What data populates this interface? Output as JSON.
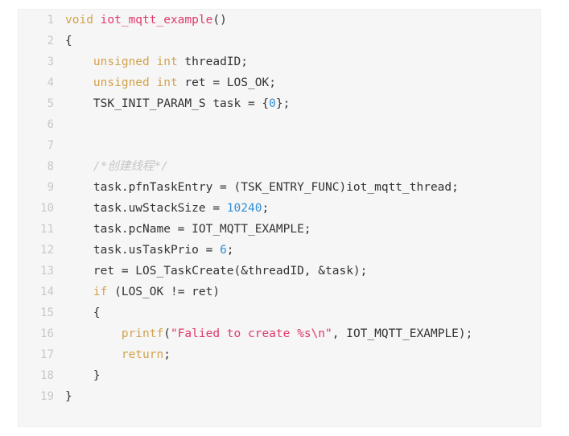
{
  "viewer": {
    "name": "code-block",
    "language": "c",
    "background_color": "#f6f6f6",
    "border_color": "#efefef",
    "gutter_color": "#c8c8c8",
    "text_color": "#333333",
    "colors": {
      "keyword": "#d2a24c",
      "function": "#e0396b",
      "string": "#e0396b",
      "number": "#2f8fd6",
      "comment": "#c6c6c6",
      "plain": "#333333"
    }
  },
  "lines": [
    {
      "number": "1",
      "tokens": [
        {
          "t": "void",
          "c": "kw"
        },
        {
          "t": " ",
          "c": "pln"
        },
        {
          "t": "iot_mqtt_example",
          "c": "fn"
        },
        {
          "t": "()",
          "c": "pln"
        }
      ]
    },
    {
      "number": "2",
      "tokens": [
        {
          "t": "{",
          "c": "pln"
        }
      ]
    },
    {
      "number": "3",
      "tokens": [
        {
          "t": "    ",
          "c": "pln"
        },
        {
          "t": "unsigned",
          "c": "kw"
        },
        {
          "t": " ",
          "c": "pln"
        },
        {
          "t": "int",
          "c": "kw"
        },
        {
          "t": " threadID;",
          "c": "pln"
        }
      ]
    },
    {
      "number": "4",
      "tokens": [
        {
          "t": "    ",
          "c": "pln"
        },
        {
          "t": "unsigned",
          "c": "kw"
        },
        {
          "t": " ",
          "c": "pln"
        },
        {
          "t": "int",
          "c": "kw"
        },
        {
          "t": " ret = LOS_OK;",
          "c": "pln"
        }
      ]
    },
    {
      "number": "5",
      "tokens": [
        {
          "t": "    TSK_INIT_PARAM_S task = {",
          "c": "pln"
        },
        {
          "t": "0",
          "c": "num"
        },
        {
          "t": "};",
          "c": "pln"
        }
      ]
    },
    {
      "number": "6",
      "tokens": []
    },
    {
      "number": "7",
      "tokens": []
    },
    {
      "number": "8",
      "tokens": [
        {
          "t": "    ",
          "c": "pln"
        },
        {
          "t": "/*创建线程*/",
          "c": "cmt"
        }
      ]
    },
    {
      "number": "9",
      "tokens": [
        {
          "t": "    task.pfnTaskEntry = (TSK_ENTRY_FUNC)iot_mqtt_thread;",
          "c": "pln"
        }
      ]
    },
    {
      "number": "10",
      "tokens": [
        {
          "t": "    task.uwStackSize = ",
          "c": "pln"
        },
        {
          "t": "10240",
          "c": "num"
        },
        {
          "t": ";",
          "c": "pln"
        }
      ]
    },
    {
      "number": "11",
      "tokens": [
        {
          "t": "    task.pcName = IOT_MQTT_EXAMPLE;",
          "c": "pln"
        }
      ]
    },
    {
      "number": "12",
      "tokens": [
        {
          "t": "    task.usTaskPrio = ",
          "c": "pln"
        },
        {
          "t": "6",
          "c": "num"
        },
        {
          "t": ";",
          "c": "pln"
        }
      ]
    },
    {
      "number": "13",
      "tokens": [
        {
          "t": "    ret = LOS_TaskCreate(&threadID, &task);",
          "c": "pln"
        }
      ]
    },
    {
      "number": "14",
      "tokens": [
        {
          "t": "    ",
          "c": "pln"
        },
        {
          "t": "if",
          "c": "kw"
        },
        {
          "t": " (LOS_OK != ret)",
          "c": "pln"
        }
      ]
    },
    {
      "number": "15",
      "tokens": [
        {
          "t": "    {",
          "c": "pln"
        }
      ]
    },
    {
      "number": "16",
      "tokens": [
        {
          "t": "        ",
          "c": "pln"
        },
        {
          "t": "printf",
          "c": "kw"
        },
        {
          "t": "(",
          "c": "pln"
        },
        {
          "t": "\"Falied to create %s\\n\"",
          "c": "str"
        },
        {
          "t": ", IOT_MQTT_EXAMPLE);",
          "c": "pln"
        }
      ]
    },
    {
      "number": "17",
      "tokens": [
        {
          "t": "        ",
          "c": "pln"
        },
        {
          "t": "return",
          "c": "kw"
        },
        {
          "t": ";",
          "c": "pln"
        }
      ]
    },
    {
      "number": "18",
      "tokens": [
        {
          "t": "    }",
          "c": "pln"
        }
      ]
    },
    {
      "number": "19",
      "tokens": [
        {
          "t": "}",
          "c": "pln"
        }
      ]
    }
  ]
}
